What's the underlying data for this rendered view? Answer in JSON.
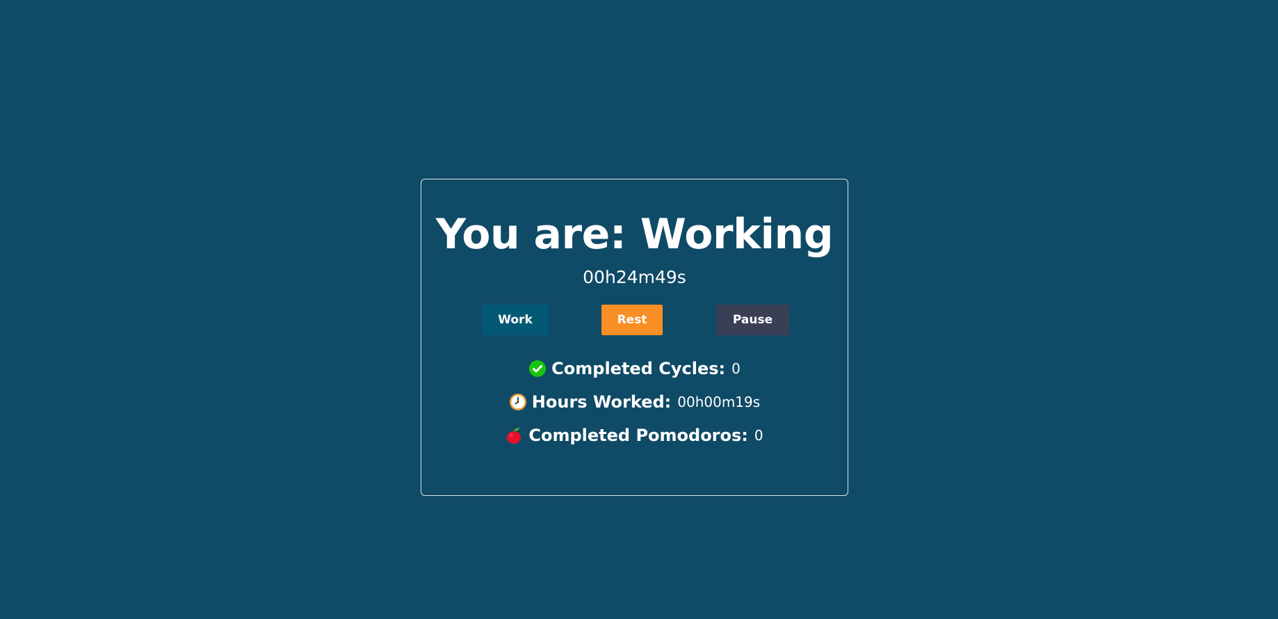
{
  "status": {
    "prefix": "You are:",
    "state": "Working",
    "title": "You are: Working"
  },
  "timer": {
    "display": "00h24m49s"
  },
  "buttons": {
    "work_label": "Work",
    "rest_label": "Rest",
    "pause_label": "Pause"
  },
  "stats": {
    "cycles": {
      "icon": "check-circle-icon",
      "label": "Completed Cycles:",
      "value": "0"
    },
    "hours": {
      "icon": "clock-icon",
      "label": "Hours Worked:",
      "value": "00h00m19s"
    },
    "pomodoros": {
      "icon": "tomato-icon",
      "label": "Completed Pomodoros:",
      "value": "0"
    }
  },
  "colors": {
    "background": "#0f4a66",
    "work_button": "#035874",
    "rest_button": "#f98e24",
    "pause_button": "#3a3f56",
    "card_border": "#dfe7ec",
    "text": "#ffffff",
    "check_green": "#16c60c",
    "tomato_red": "#e8112d"
  }
}
